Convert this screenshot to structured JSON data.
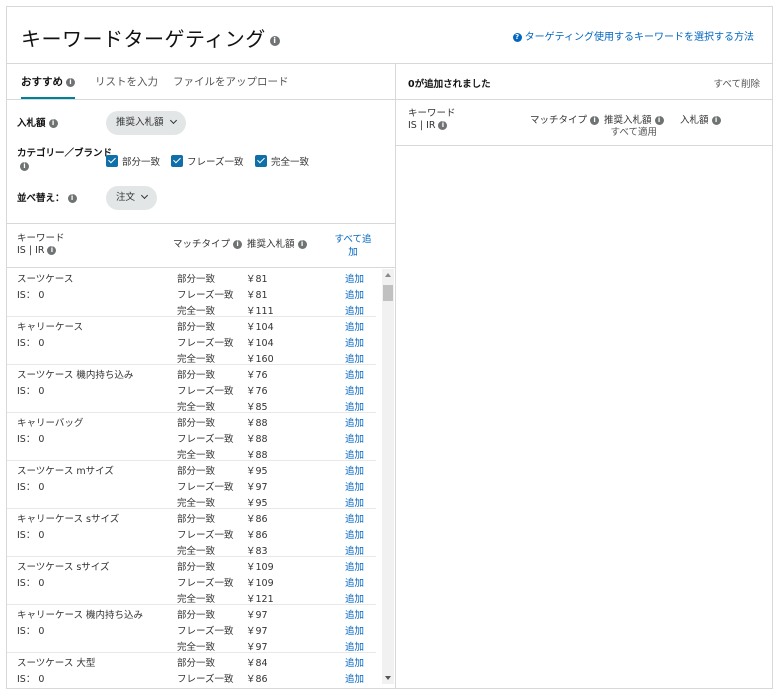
{
  "header": {
    "title": "キーワードターゲティング",
    "help_link": "ターゲティング使用するキーワードを選択する方法"
  },
  "tabs": [
    {
      "label": "おすすめ"
    },
    {
      "label": "リストを入力"
    },
    {
      "label": "ファイルをアップロード"
    }
  ],
  "filters": {
    "bid_label": "入札額",
    "bid_value": "推奨入札額",
    "category_label": "カテゴリー／ブランド",
    "match_options": [
      "部分一致",
      "フレーズ一致",
      "完全一致"
    ],
    "sort_label": "並べ替え：",
    "sort_value": "注文"
  },
  "columns": {
    "keyword": "キーワード",
    "is_ir": "IS | IR",
    "match_type": "マッチタイプ",
    "suggested_bid": "推奨入札額",
    "add_all": "すべて追加"
  },
  "keywords": [
    {
      "name": "スーツケース",
      "is": "IS： 0",
      "rows": [
        {
          "match": "部分一致",
          "bid": "￥81",
          "action": "追加"
        },
        {
          "match": "フレーズ一致",
          "bid": "￥81",
          "action": "追加"
        },
        {
          "match": "完全一致",
          "bid": "￥111",
          "action": "追加"
        }
      ]
    },
    {
      "name": "キャリーケース",
      "is": "IS： 0",
      "rows": [
        {
          "match": "部分一致",
          "bid": "￥104",
          "action": "追加"
        },
        {
          "match": "フレーズ一致",
          "bid": "￥104",
          "action": "追加"
        },
        {
          "match": "完全一致",
          "bid": "￥160",
          "action": "追加"
        }
      ]
    },
    {
      "name": "スーツケース 機内持ち込み",
      "is": "IS： 0",
      "rows": [
        {
          "match": "部分一致",
          "bid": "￥76",
          "action": "追加"
        },
        {
          "match": "フレーズ一致",
          "bid": "￥76",
          "action": "追加"
        },
        {
          "match": "完全一致",
          "bid": "￥85",
          "action": "追加"
        }
      ]
    },
    {
      "name": "キャリーバッグ",
      "is": "IS： 0",
      "rows": [
        {
          "match": "部分一致",
          "bid": "￥88",
          "action": "追加"
        },
        {
          "match": "フレーズ一致",
          "bid": "￥88",
          "action": "追加"
        },
        {
          "match": "完全一致",
          "bid": "￥88",
          "action": "追加"
        }
      ]
    },
    {
      "name": "スーツケース mサイズ",
      "is": "IS： 0",
      "rows": [
        {
          "match": "部分一致",
          "bid": "￥95",
          "action": "追加"
        },
        {
          "match": "フレーズ一致",
          "bid": "￥97",
          "action": "追加"
        },
        {
          "match": "完全一致",
          "bid": "￥95",
          "action": "追加"
        }
      ]
    },
    {
      "name": "キャリーケース sサイズ",
      "is": "IS： 0",
      "rows": [
        {
          "match": "部分一致",
          "bid": "￥86",
          "action": "追加"
        },
        {
          "match": "フレーズ一致",
          "bid": "￥86",
          "action": "追加"
        },
        {
          "match": "完全一致",
          "bid": "￥83",
          "action": "追加"
        }
      ]
    },
    {
      "name": "スーツケース sサイズ",
      "is": "IS： 0",
      "rows": [
        {
          "match": "部分一致",
          "bid": "￥109",
          "action": "追加"
        },
        {
          "match": "フレーズ一致",
          "bid": "￥109",
          "action": "追加"
        },
        {
          "match": "完全一致",
          "bid": "￥121",
          "action": "追加"
        }
      ]
    },
    {
      "name": "キャリーケース 機内持ち込み",
      "is": "IS： 0",
      "rows": [
        {
          "match": "部分一致",
          "bid": "￥97",
          "action": "追加"
        },
        {
          "match": "フレーズ一致",
          "bid": "￥97",
          "action": "追加"
        },
        {
          "match": "完全一致",
          "bid": "￥97",
          "action": "追加"
        }
      ]
    },
    {
      "name": "スーツケース 大型",
      "is": "IS： 0",
      "rows": [
        {
          "match": "部分一致",
          "bid": "￥84",
          "action": "追加"
        },
        {
          "match": "フレーズ一致",
          "bid": "￥86",
          "action": "追加"
        }
      ]
    }
  ],
  "right_panel": {
    "added_count": "0が追加されました",
    "remove_all": "すべて削除",
    "keyword": "キーワード",
    "is_ir": "IS | IR",
    "match_type": "マッチタイプ",
    "suggested_bid": "推奨入札額",
    "apply_all": "すべて適用",
    "bid": "入札額"
  }
}
